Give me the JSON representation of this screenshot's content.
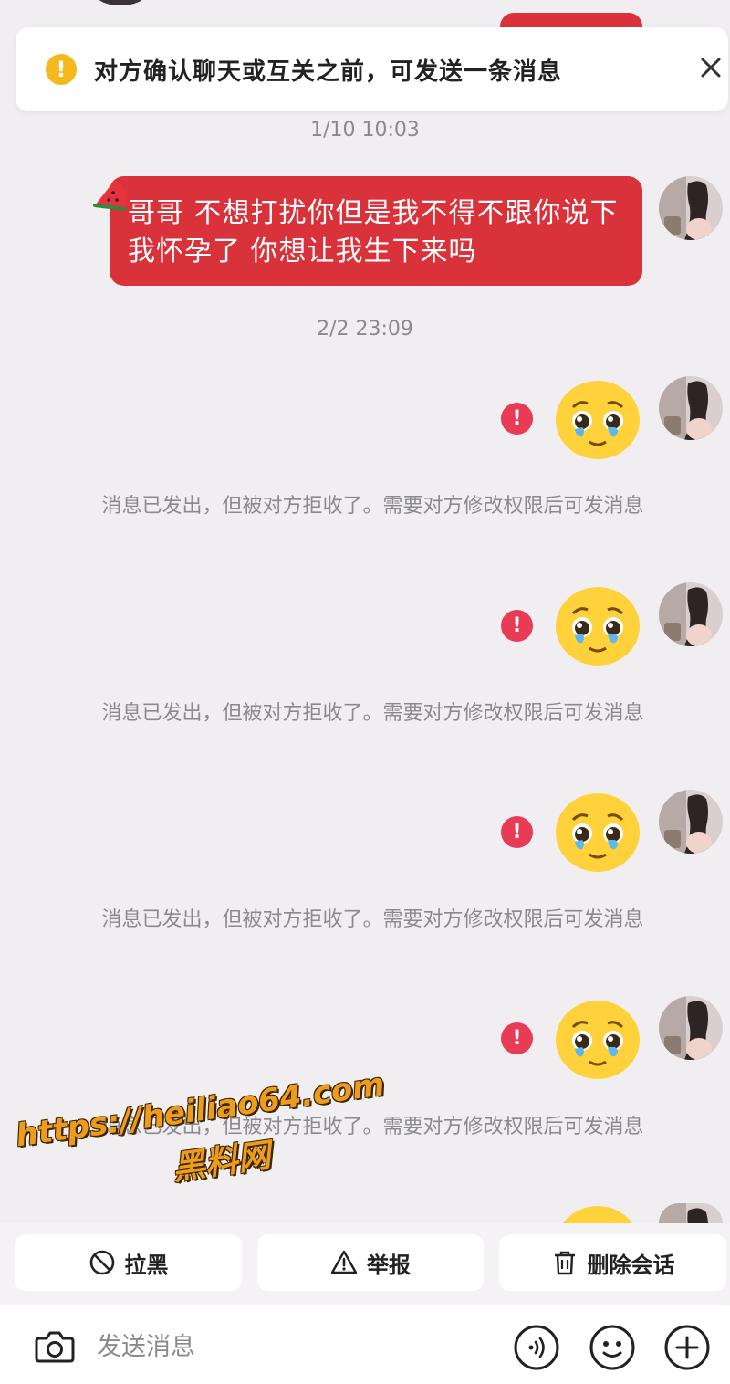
{
  "notice": {
    "text": "对方确认聊天或互关之前，可发送一条消息"
  },
  "conversation": {
    "timestamp_1": "1/10 10:03",
    "message_1": "哥哥 不想打扰你但是我不得不跟你说下 我怀孕了 你想让我生下来吗",
    "timestamp_2": "2/2 23:09",
    "error_mark": "!",
    "reject_notice": "消息已发出，但被对方拒收了。需要对方修改权限后可发消息"
  },
  "watermark": {
    "url": "https://heiliao64.com",
    "name": "黑料网"
  },
  "actions": {
    "block_label": "拉黑",
    "report_label": "举报",
    "delete_label": "删除会话"
  },
  "composer": {
    "placeholder": "发送消息"
  },
  "colors": {
    "bubble": "#d9323b",
    "error": "#e83b55",
    "warning": "#f6b91c",
    "watermark": "#ef9b1b"
  }
}
